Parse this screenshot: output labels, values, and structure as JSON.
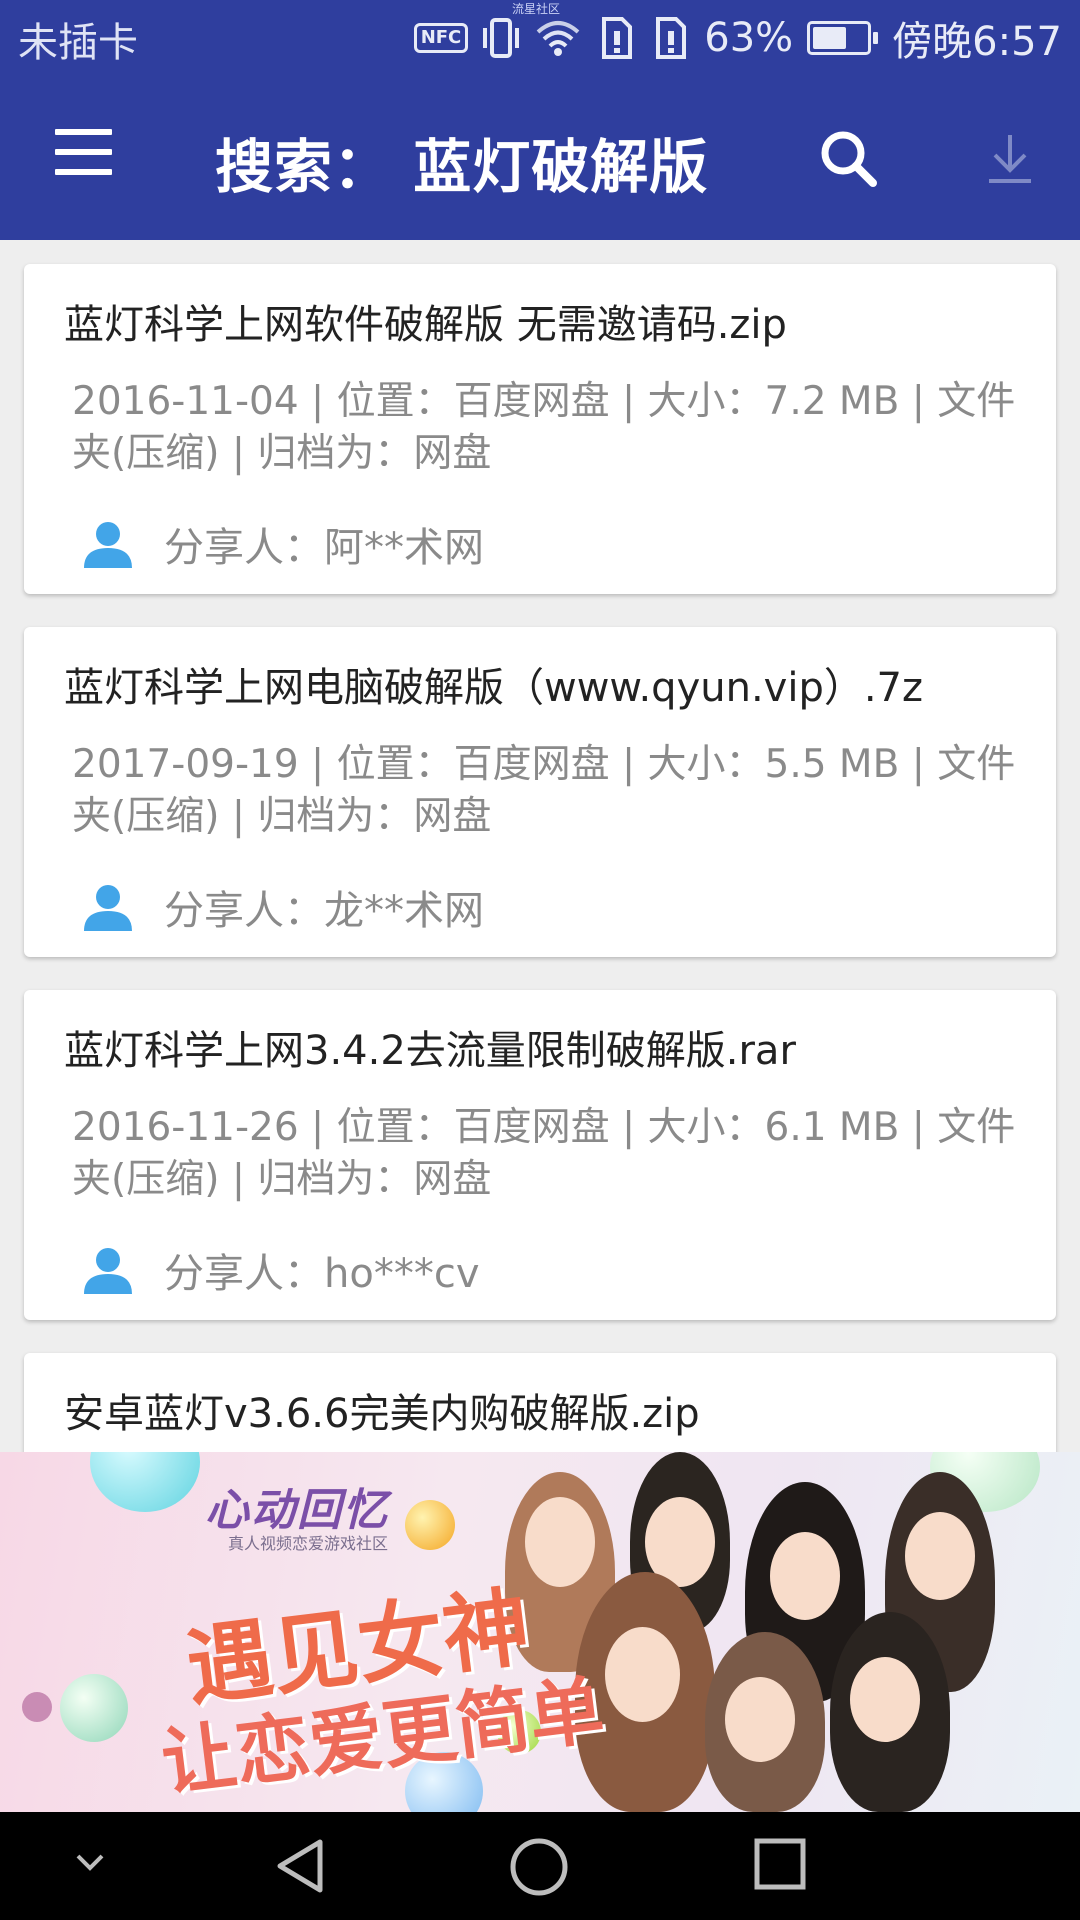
{
  "status_bar": {
    "carrier": "未插卡",
    "tag": "流星社区",
    "nfc": "NFC",
    "battery_percent": "63%",
    "battery_level": 0.63,
    "time": "傍晚6:57"
  },
  "toolbar": {
    "title": "搜索：  蓝灯破解版",
    "menu_icon": "menu-icon",
    "search_icon": "search-icon",
    "download_icon": "download-icon"
  },
  "results": [
    {
      "title": "蓝灯科学上网软件破解版 无需邀请码.zip",
      "meta": "2016-11-04 | 位置：百度网盘 | 大小：7.2 MB | 文件夹(压缩) | 归档为：网盘",
      "sharer": "分享人：阿**术网"
    },
    {
      "title": "蓝灯科学上网电脑破解版（www.qyun.vip）.7z",
      "meta": "2017-09-19 | 位置：百度网盘 | 大小：5.5 MB | 文件夹(压缩) | 归档为：网盘",
      "sharer": "分享人：龙**术网"
    },
    {
      "title": "蓝灯科学上网3.4.2去流量限制破解版.rar",
      "meta": "2016-11-26 | 位置：百度网盘 | 大小：6.1 MB | 文件夹(压缩) | 归档为：网盘",
      "sharer": "分享人：ho***cv"
    },
    {
      "title": "安卓蓝灯v3.6.6完美内购破解版.zip"
    }
  ],
  "ad": {
    "logo": "心动回忆",
    "subtitle": "真人视频恋爱游戏社区",
    "headline_1": "遇见女神",
    "headline_2": "让恋爱更简单"
  },
  "nav": {
    "collapse_icon": "chevron-down-icon",
    "back_icon": "back-icon",
    "home_icon": "home-icon",
    "recents_icon": "recents-icon"
  },
  "colors": {
    "header": "#2f3e9e",
    "accent_icon": "#42a5e8",
    "meta_text": "#8a8a8a",
    "background": "#eeeeee"
  }
}
